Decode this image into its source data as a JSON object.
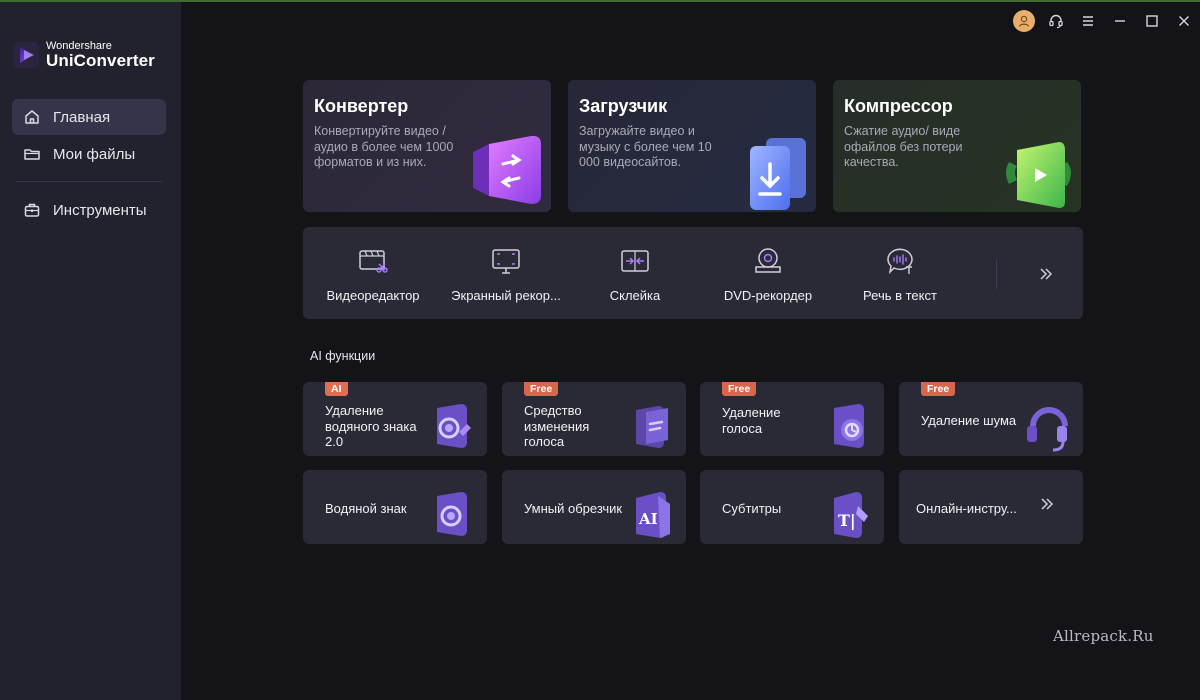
{
  "app": {
    "brand": "Wondershare",
    "product": "UniConverter"
  },
  "sidebar": {
    "items": [
      {
        "label": "Главная",
        "icon": "home-icon",
        "active": true
      },
      {
        "label": "Мои файлы",
        "icon": "folder-icon",
        "active": false
      },
      {
        "label": "Инструменты",
        "icon": "toolbox-icon",
        "active": false
      }
    ]
  },
  "titlebar": {
    "icons": [
      "avatar-icon",
      "headset-icon",
      "menu-icon",
      "minimize-icon",
      "maximize-icon",
      "close-icon"
    ]
  },
  "cards": [
    {
      "title": "Конвертер",
      "desc": "Конвертируйте видео / аудио в более чем 1000 форматов и из них."
    },
    {
      "title": "Загрузчик",
      "desc": "Загружайте видео и музыку с более чем 10 000 видеосайтов."
    },
    {
      "title": "Компрессор",
      "desc": "Сжатие аудио/ виде офайлов без потери качества."
    }
  ],
  "tools": [
    {
      "label": "Видеоредактор",
      "icon": "video-editor-icon"
    },
    {
      "label": "Экранный рекор...",
      "icon": "screen-recorder-icon"
    },
    {
      "label": "Склейка",
      "icon": "merge-icon"
    },
    {
      "label": "DVD-рекордер",
      "icon": "dvd-icon"
    },
    {
      "label": "Речь в текст",
      "icon": "speech-to-text-icon"
    }
  ],
  "ai_section": {
    "title": "AI функции",
    "cards": [
      {
        "badge": "AI",
        "label": "Удаление водяного знака 2.0"
      },
      {
        "badge": "Free",
        "label": "Средство изменения голоса"
      },
      {
        "badge": "Free",
        "label": "Удаление голоса"
      },
      {
        "badge": "Free",
        "label": "Удаление шума"
      },
      {
        "badge": "",
        "label": "Водяной знак"
      },
      {
        "badge": "",
        "label": "Умный обрезчик"
      },
      {
        "badge": "",
        "label": "Субтитры"
      },
      {
        "badge": "",
        "label": "Онлайн-инстру..."
      }
    ]
  },
  "watermark": "Allrepack.Ru",
  "colors": {
    "background": "#141418",
    "sidebar": "#22222e",
    "card": "#2a2a36",
    "accent_purple": "#8a5cf5",
    "badge_orange": "#d6664c"
  }
}
